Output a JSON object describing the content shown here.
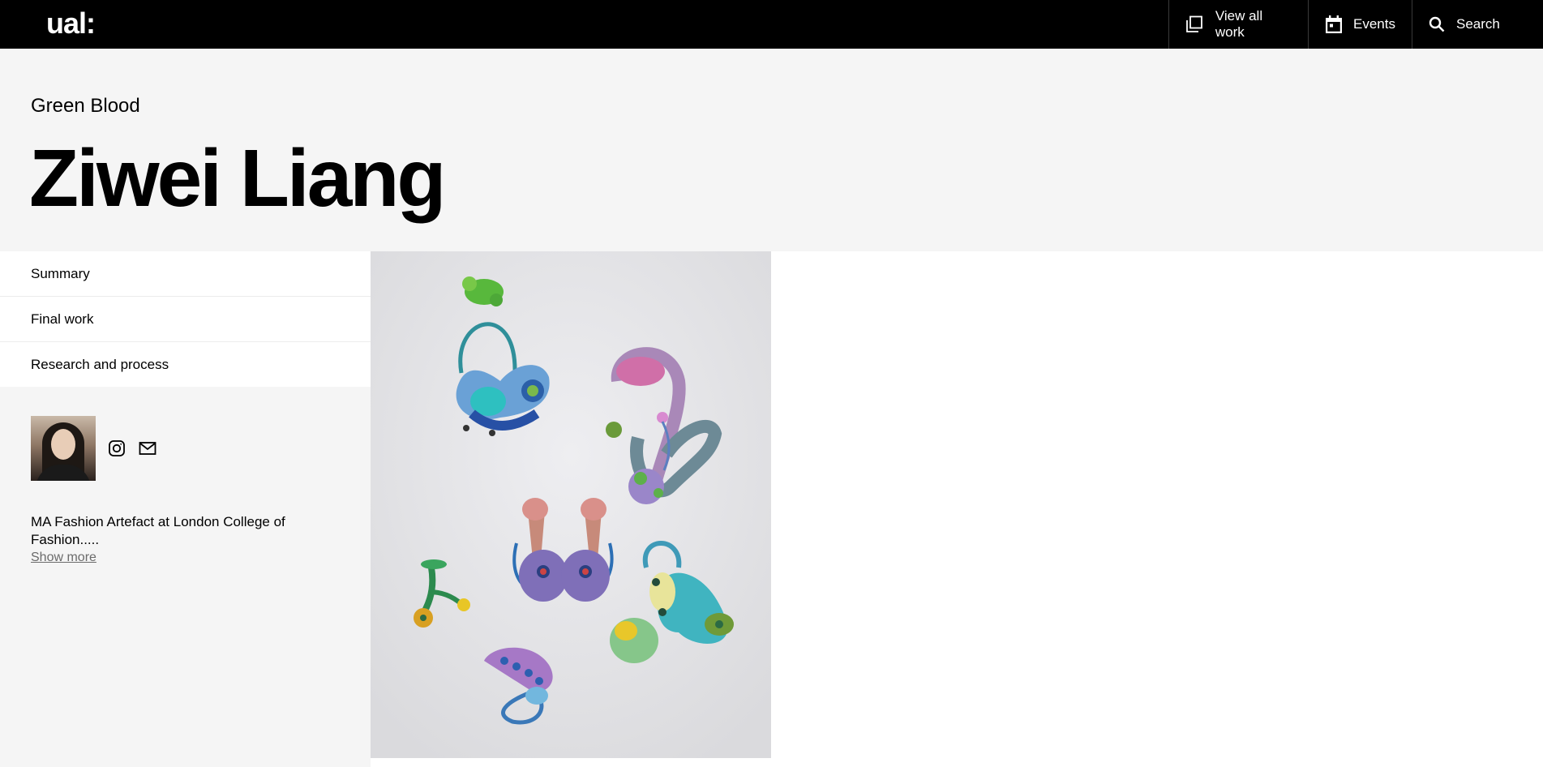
{
  "header": {
    "logo": "ual:",
    "nav": [
      {
        "label": "View all work",
        "icon": "gallery-icon"
      },
      {
        "label": "Events",
        "icon": "calendar-icon"
      },
      {
        "label": "Search",
        "icon": "search-icon"
      }
    ]
  },
  "hero": {
    "subtitle": "Green Blood",
    "title": "Ziwei Liang"
  },
  "sidebar": {
    "links": [
      "Summary",
      "Final work",
      "Research and process"
    ],
    "social": [
      "instagram-icon",
      "email-icon"
    ],
    "bio": "MA Fashion Artefact at London College of Fashion.....",
    "show_more": "Show more"
  },
  "colors": {
    "topbar": "#000000",
    "hero_bg": "#f5f5f5",
    "text": "#000000",
    "muted": "#6b6b6b"
  }
}
